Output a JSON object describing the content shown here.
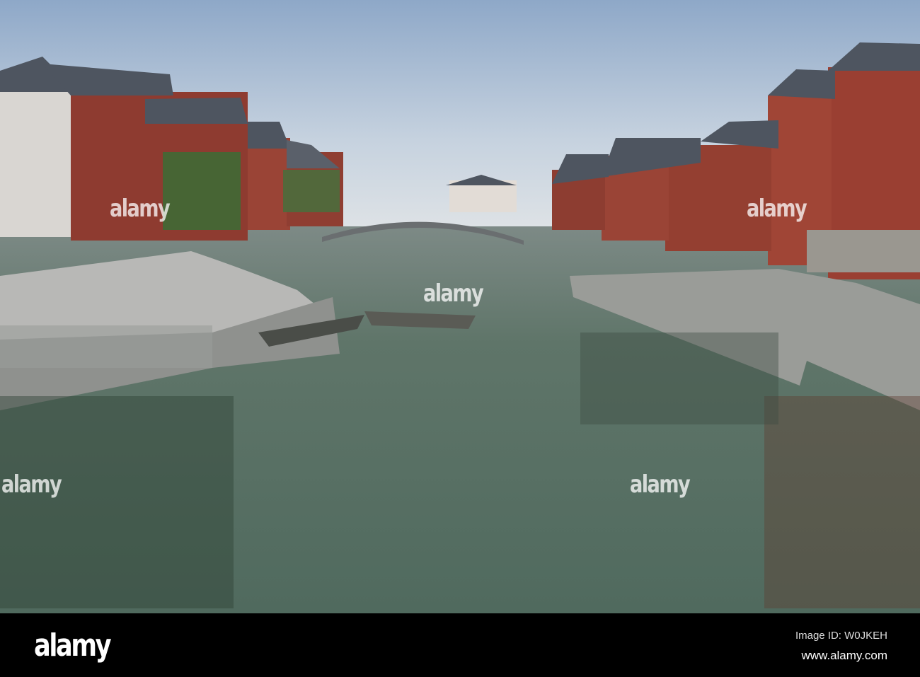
{
  "watermark": {
    "text": "alamy"
  },
  "footer": {
    "logo": "alamy",
    "image_id": "Image ID: W0JKEH",
    "website": "www.alamy.com"
  }
}
